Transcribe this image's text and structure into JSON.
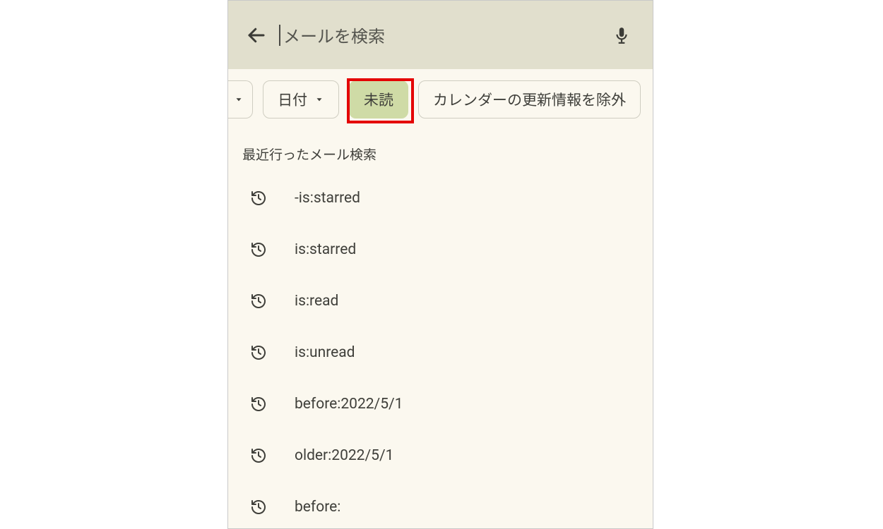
{
  "search": {
    "placeholder": "メールを検索"
  },
  "chips": {
    "date": "日付",
    "unread": "未読",
    "exclude_calendar": "カレンダーの更新情報を除外"
  },
  "section_title": "最近行ったメール検索",
  "history": [
    "-is:starred",
    "is:starred",
    "is:read",
    "is:unread",
    "before:2022/5/1",
    "older:2022/5/1",
    "before:"
  ]
}
